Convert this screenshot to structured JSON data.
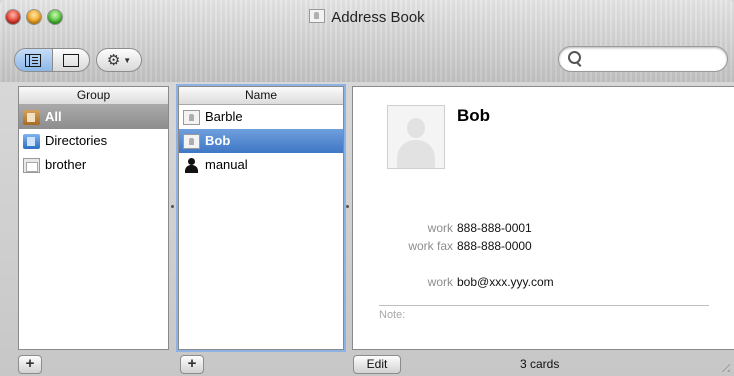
{
  "window": {
    "title": "Address Book"
  },
  "toolbar": {
    "view_icons": [
      "columns-view-icon",
      "card-view-icon"
    ],
    "action_icon": "gear-icon",
    "search_placeholder": ""
  },
  "groups": {
    "header": "Group",
    "items": [
      {
        "label": "All",
        "icon": "folder-icon",
        "selected": true
      },
      {
        "label": "Directories",
        "icon": "directory-icon",
        "selected": false
      },
      {
        "label": "brother",
        "icon": "group-icon",
        "selected": false
      }
    ]
  },
  "names": {
    "header": "Name",
    "items": [
      {
        "label": "Barble",
        "icon": "card-icon",
        "selected": false
      },
      {
        "label": "Bob",
        "icon": "card-icon",
        "selected": true
      },
      {
        "label": "manual",
        "icon": "person-icon",
        "selected": false
      }
    ]
  },
  "card": {
    "name": "Bob",
    "fields": [
      {
        "label": "work",
        "value": "888-888-0001"
      },
      {
        "label": "work fax",
        "value": "888-888-0000"
      },
      {
        "label": "work",
        "value": "bob@xxx.yyy.com"
      }
    ],
    "note_label": "Note:"
  },
  "footer": {
    "add_symbol": "+",
    "edit_label": "Edit",
    "count": "3 cards"
  }
}
